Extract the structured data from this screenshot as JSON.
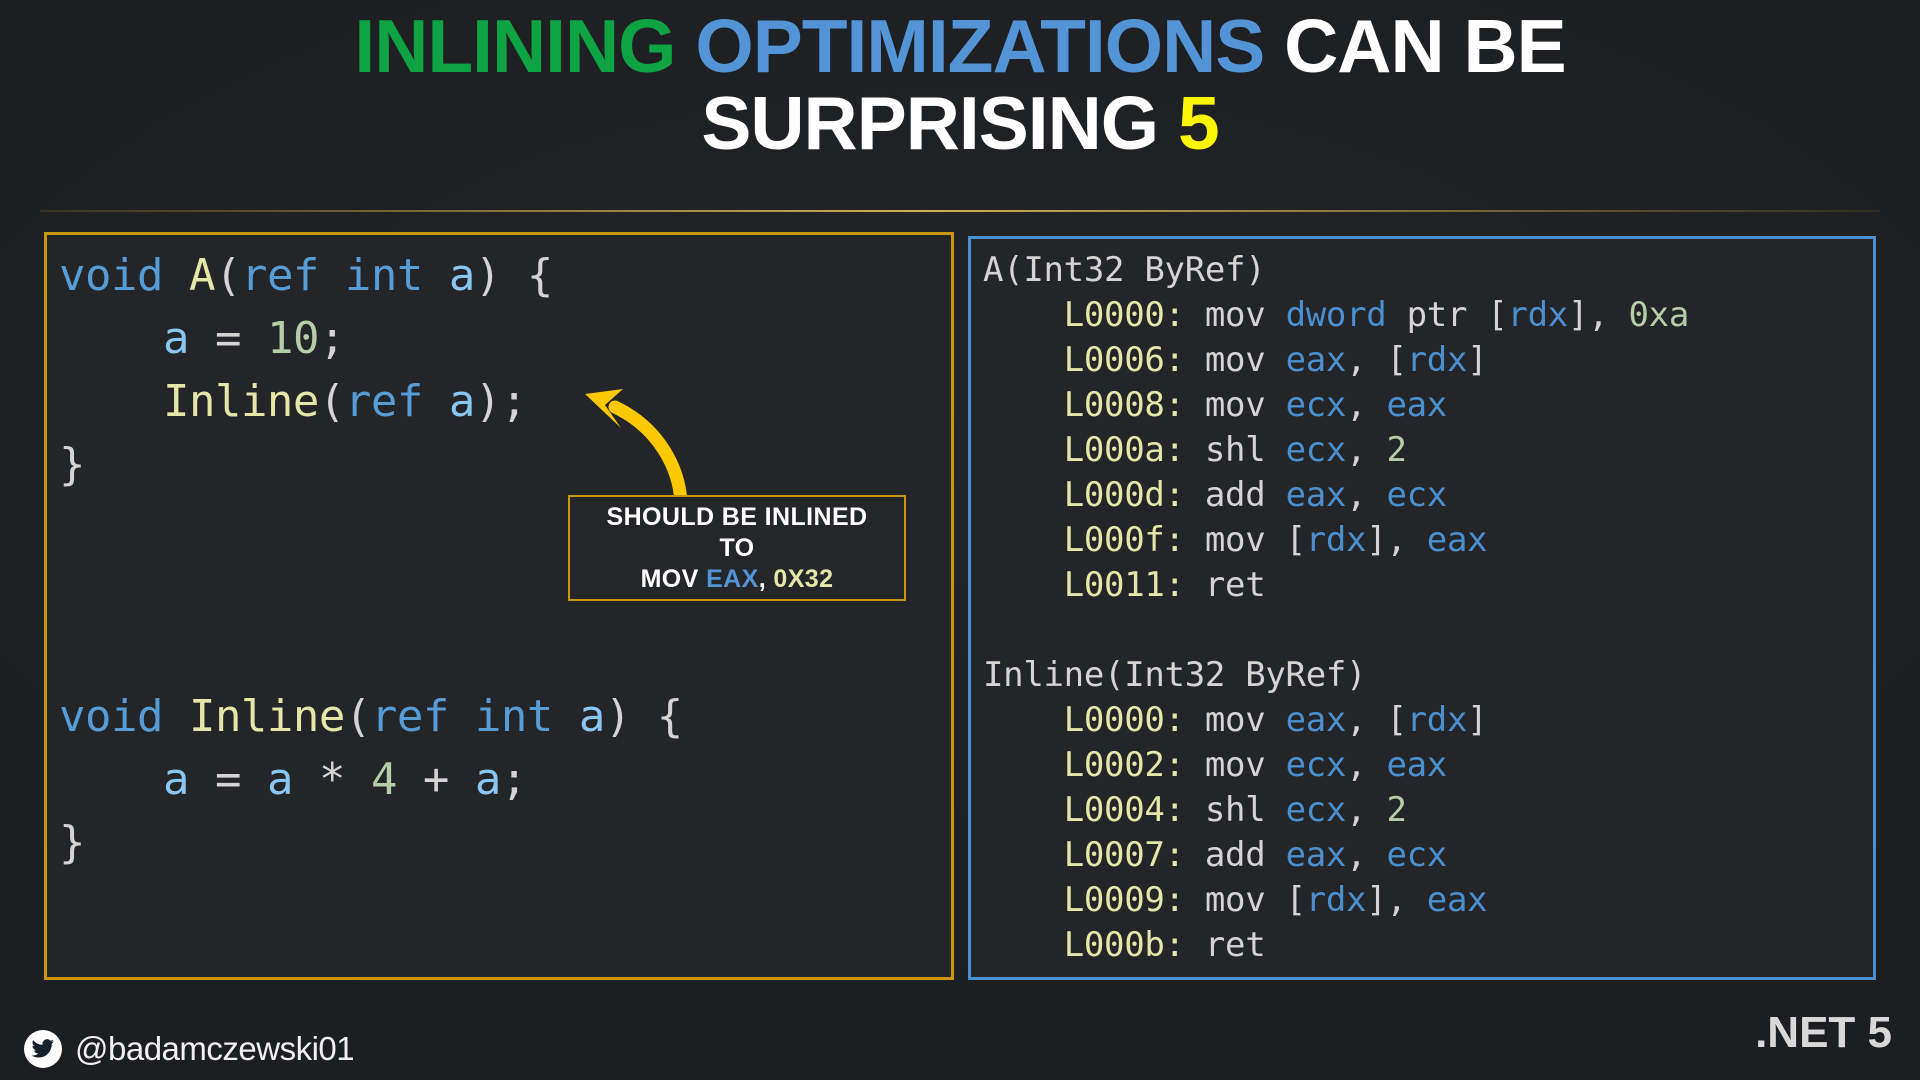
{
  "slide": {
    "background_color": "#202124",
    "title": {
      "line1_parts": [
        {
          "text": "INLINING",
          "color": "#0ea343"
        },
        {
          "text": "OPTIMIZATIONS",
          "color": "#5294d6"
        },
        {
          "text": "CAN BE",
          "color": "#ffffff"
        }
      ],
      "line2_parts": [
        {
          "text": "SURPRISING",
          "color": "#ffffff"
        },
        {
          "text": "5",
          "color": "#fbf500"
        }
      ],
      "full_text": "INLINING OPTIMIZATIONS CAN BE SURPRISING 5"
    },
    "divider_color": "#c9960c"
  },
  "left_panel": {
    "border_color": "#c9960c",
    "language": "csharp",
    "lines": [
      [
        {
          "t": "void ",
          "c": "k"
        },
        {
          "t": "A",
          "c": "fn"
        },
        {
          "t": "(",
          "c": "p"
        },
        {
          "t": "ref int ",
          "c": "k"
        },
        {
          "t": "a",
          "c": "var"
        },
        {
          "t": ") {",
          "c": "p"
        }
      ],
      [
        {
          "t": "    ",
          "c": "p"
        },
        {
          "t": "a",
          "c": "var"
        },
        {
          "t": " = ",
          "c": "p"
        },
        {
          "t": "10",
          "c": "num"
        },
        {
          "t": ";",
          "c": "p"
        }
      ],
      [
        {
          "t": "    ",
          "c": "p"
        },
        {
          "t": "Inline",
          "c": "fn"
        },
        {
          "t": "(",
          "c": "p"
        },
        {
          "t": "ref ",
          "c": "k"
        },
        {
          "t": "a",
          "c": "var"
        },
        {
          "t": ");",
          "c": "p"
        }
      ],
      [
        {
          "t": "}",
          "c": "p"
        }
      ],
      [
        {
          "t": " ",
          "c": "p"
        }
      ],
      [
        {
          "t": " ",
          "c": "p"
        }
      ],
      [
        {
          "t": " ",
          "c": "p"
        }
      ],
      [
        {
          "t": "void ",
          "c": "k"
        },
        {
          "t": "Inline",
          "c": "fn"
        },
        {
          "t": "(",
          "c": "p"
        },
        {
          "t": "ref int ",
          "c": "k"
        },
        {
          "t": "a",
          "c": "var"
        },
        {
          "t": ") {",
          "c": "p"
        }
      ],
      [
        {
          "t": "    ",
          "c": "p"
        },
        {
          "t": "a",
          "c": "var"
        },
        {
          "t": " = ",
          "c": "p"
        },
        {
          "t": "a",
          "c": "var"
        },
        {
          "t": " * ",
          "c": "p"
        },
        {
          "t": "4",
          "c": "num"
        },
        {
          "t": " + ",
          "c": "p"
        },
        {
          "t": "a",
          "c": "var"
        },
        {
          "t": ";",
          "c": "p"
        }
      ],
      [
        {
          "t": "}",
          "c": "p"
        }
      ]
    ],
    "plain_text": "void A(ref int a) {\n    a = 10;\n    Inline(ref a);\n}\n\n\n\nvoid Inline(ref int a) {\n    a = a * 4 + a;\n}"
  },
  "right_panel": {
    "border_color": "#4a90d0",
    "language": "x86-asm",
    "lines": [
      [
        {
          "t": "A(Int32 ByRef)",
          "c": "hdr"
        }
      ],
      [
        {
          "t": "    ",
          "c": "mn"
        },
        {
          "t": "L0000:",
          "c": "lbl"
        },
        {
          "t": " mov ",
          "c": "mn"
        },
        {
          "t": "dword",
          "c": "reg"
        },
        {
          "t": " ptr ",
          "c": "mn"
        },
        {
          "t": "[",
          "c": "mn"
        },
        {
          "t": "rdx",
          "c": "reg"
        },
        {
          "t": "], ",
          "c": "mn"
        },
        {
          "t": "0xa",
          "c": "num"
        }
      ],
      [
        {
          "t": "    ",
          "c": "mn"
        },
        {
          "t": "L0006:",
          "c": "lbl"
        },
        {
          "t": " mov ",
          "c": "mn"
        },
        {
          "t": "eax",
          "c": "reg"
        },
        {
          "t": ", ",
          "c": "mn"
        },
        {
          "t": "[",
          "c": "mn"
        },
        {
          "t": "rdx",
          "c": "reg"
        },
        {
          "t": "]",
          "c": "mn"
        }
      ],
      [
        {
          "t": "    ",
          "c": "mn"
        },
        {
          "t": "L0008:",
          "c": "lbl"
        },
        {
          "t": " mov ",
          "c": "mn"
        },
        {
          "t": "ecx",
          "c": "reg"
        },
        {
          "t": ", ",
          "c": "mn"
        },
        {
          "t": "eax",
          "c": "reg"
        }
      ],
      [
        {
          "t": "    ",
          "c": "mn"
        },
        {
          "t": "L000a:",
          "c": "lbl"
        },
        {
          "t": " shl ",
          "c": "mn"
        },
        {
          "t": "ecx",
          "c": "reg"
        },
        {
          "t": ", ",
          "c": "mn"
        },
        {
          "t": "2",
          "c": "num"
        }
      ],
      [
        {
          "t": "    ",
          "c": "mn"
        },
        {
          "t": "L000d:",
          "c": "lbl"
        },
        {
          "t": " add ",
          "c": "mn"
        },
        {
          "t": "eax",
          "c": "reg"
        },
        {
          "t": ", ",
          "c": "mn"
        },
        {
          "t": "ecx",
          "c": "reg"
        }
      ],
      [
        {
          "t": "    ",
          "c": "mn"
        },
        {
          "t": "L000f:",
          "c": "lbl"
        },
        {
          "t": " mov ",
          "c": "mn"
        },
        {
          "t": "[",
          "c": "mn"
        },
        {
          "t": "rdx",
          "c": "reg"
        },
        {
          "t": "], ",
          "c": "mn"
        },
        {
          "t": "eax",
          "c": "reg"
        }
      ],
      [
        {
          "t": "    ",
          "c": "mn"
        },
        {
          "t": "L0011:",
          "c": "lbl"
        },
        {
          "t": " ret",
          "c": "mn"
        }
      ],
      [
        {
          "t": " ",
          "c": "mn"
        }
      ],
      [
        {
          "t": "Inline(Int32 ByRef)",
          "c": "hdr"
        }
      ],
      [
        {
          "t": "    ",
          "c": "mn"
        },
        {
          "t": "L0000:",
          "c": "lbl"
        },
        {
          "t": " mov ",
          "c": "mn"
        },
        {
          "t": "eax",
          "c": "reg"
        },
        {
          "t": ", ",
          "c": "mn"
        },
        {
          "t": "[",
          "c": "mn"
        },
        {
          "t": "rdx",
          "c": "reg"
        },
        {
          "t": "]",
          "c": "mn"
        }
      ],
      [
        {
          "t": "    ",
          "c": "mn"
        },
        {
          "t": "L0002:",
          "c": "lbl"
        },
        {
          "t": " mov ",
          "c": "mn"
        },
        {
          "t": "ecx",
          "c": "reg"
        },
        {
          "t": ", ",
          "c": "mn"
        },
        {
          "t": "eax",
          "c": "reg"
        }
      ],
      [
        {
          "t": "    ",
          "c": "mn"
        },
        {
          "t": "L0004:",
          "c": "lbl"
        },
        {
          "t": " shl ",
          "c": "mn"
        },
        {
          "t": "ecx",
          "c": "reg"
        },
        {
          "t": ", ",
          "c": "mn"
        },
        {
          "t": "2",
          "c": "num"
        }
      ],
      [
        {
          "t": "    ",
          "c": "mn"
        },
        {
          "t": "L0007:",
          "c": "lbl"
        },
        {
          "t": " add ",
          "c": "mn"
        },
        {
          "t": "eax",
          "c": "reg"
        },
        {
          "t": ", ",
          "c": "mn"
        },
        {
          "t": "ecx",
          "c": "reg"
        }
      ],
      [
        {
          "t": "    ",
          "c": "mn"
        },
        {
          "t": "L0009:",
          "c": "lbl"
        },
        {
          "t": " mov ",
          "c": "mn"
        },
        {
          "t": "[",
          "c": "mn"
        },
        {
          "t": "rdx",
          "c": "reg"
        },
        {
          "t": "], ",
          "c": "mn"
        },
        {
          "t": "eax",
          "c": "reg"
        }
      ],
      [
        {
          "t": "    ",
          "c": "mn"
        },
        {
          "t": "L000b:",
          "c": "lbl"
        },
        {
          "t": " ret",
          "c": "mn"
        }
      ]
    ],
    "plain_text": "A(Int32 ByRef)\n    L0000: mov dword ptr [rdx], 0xa\n    L0006: mov eax, [rdx]\n    L0008: mov ecx, eax\n    L000a: shl ecx, 2\n    L000d: add eax, ecx\n    L000f: mov [rdx], eax\n    L0011: ret\n\nInline(Int32 ByRef)\n    L0000: mov eax, [rdx]\n    L0002: mov ecx, eax\n    L0004: shl ecx, 2\n    L0007: add eax, ecx\n    L0009: mov [rdx], eax\n    L000b: ret"
  },
  "callout": {
    "border_color": "#c9960c",
    "arrow_color": "#fcc800",
    "arrow_icon": "curved-arrow-up-left-icon",
    "line1": "SHOULD BE INLINED",
    "line2": "TO",
    "line3_parts": [
      {
        "text": "MOV ",
        "color": "#ffffff"
      },
      {
        "text": "EAX",
        "color": "#5294d6"
      },
      {
        "text": ", ",
        "color": "#ffffff"
      },
      {
        "text": "0X32",
        "color": "#e6e6a8"
      }
    ],
    "line3_mnemonic": "MOV",
    "line3_register": "EAX",
    "line3_separator": ",",
    "line3_value": "0X32"
  },
  "footer": {
    "twitter_icon": "twitter-bird-icon",
    "handle": "@badamczewski01",
    "framework_badge": ".NET 5"
  }
}
